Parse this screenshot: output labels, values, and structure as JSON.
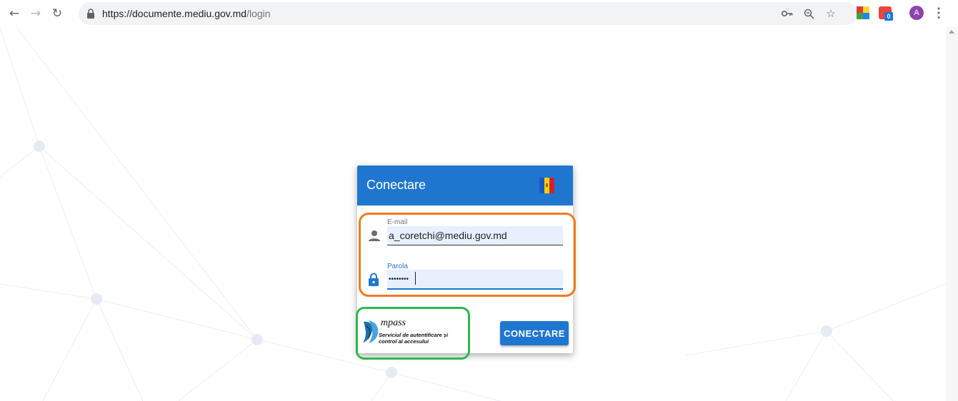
{
  "browser": {
    "url_host": "https://documente.mediu.gov.md",
    "url_path": "/login",
    "profile_initial": "A",
    "extension_badge": "0"
  },
  "login": {
    "title": "Conectare",
    "email_label": "E-mail",
    "email_value": "a_coretchi@mediu.gov.md",
    "password_label": "Parola",
    "password_value": "••••••••",
    "submit_label": "CONECTARE"
  },
  "mpass": {
    "name": "mpass",
    "tagline_line1": "Serviciul de autentificare și",
    "tagline_line2": "control al accesului"
  },
  "colors": {
    "primary": "#1e76cf",
    "field_bg": "#e8f0fe",
    "highlight_orange": "#f07b22",
    "highlight_green": "#2db84d",
    "flag_blue": "#1a56c2",
    "flag_yellow": "#f5d000",
    "flag_red": "#d6202f"
  },
  "icons": {
    "back": "arrow-left-icon",
    "forward": "arrow-right-icon",
    "reload": "reload-icon",
    "lock": "lock-icon",
    "key": "key-icon",
    "zoom": "zoom-icon",
    "star": "star-icon",
    "user": "person-icon",
    "password": "padlock-icon"
  }
}
